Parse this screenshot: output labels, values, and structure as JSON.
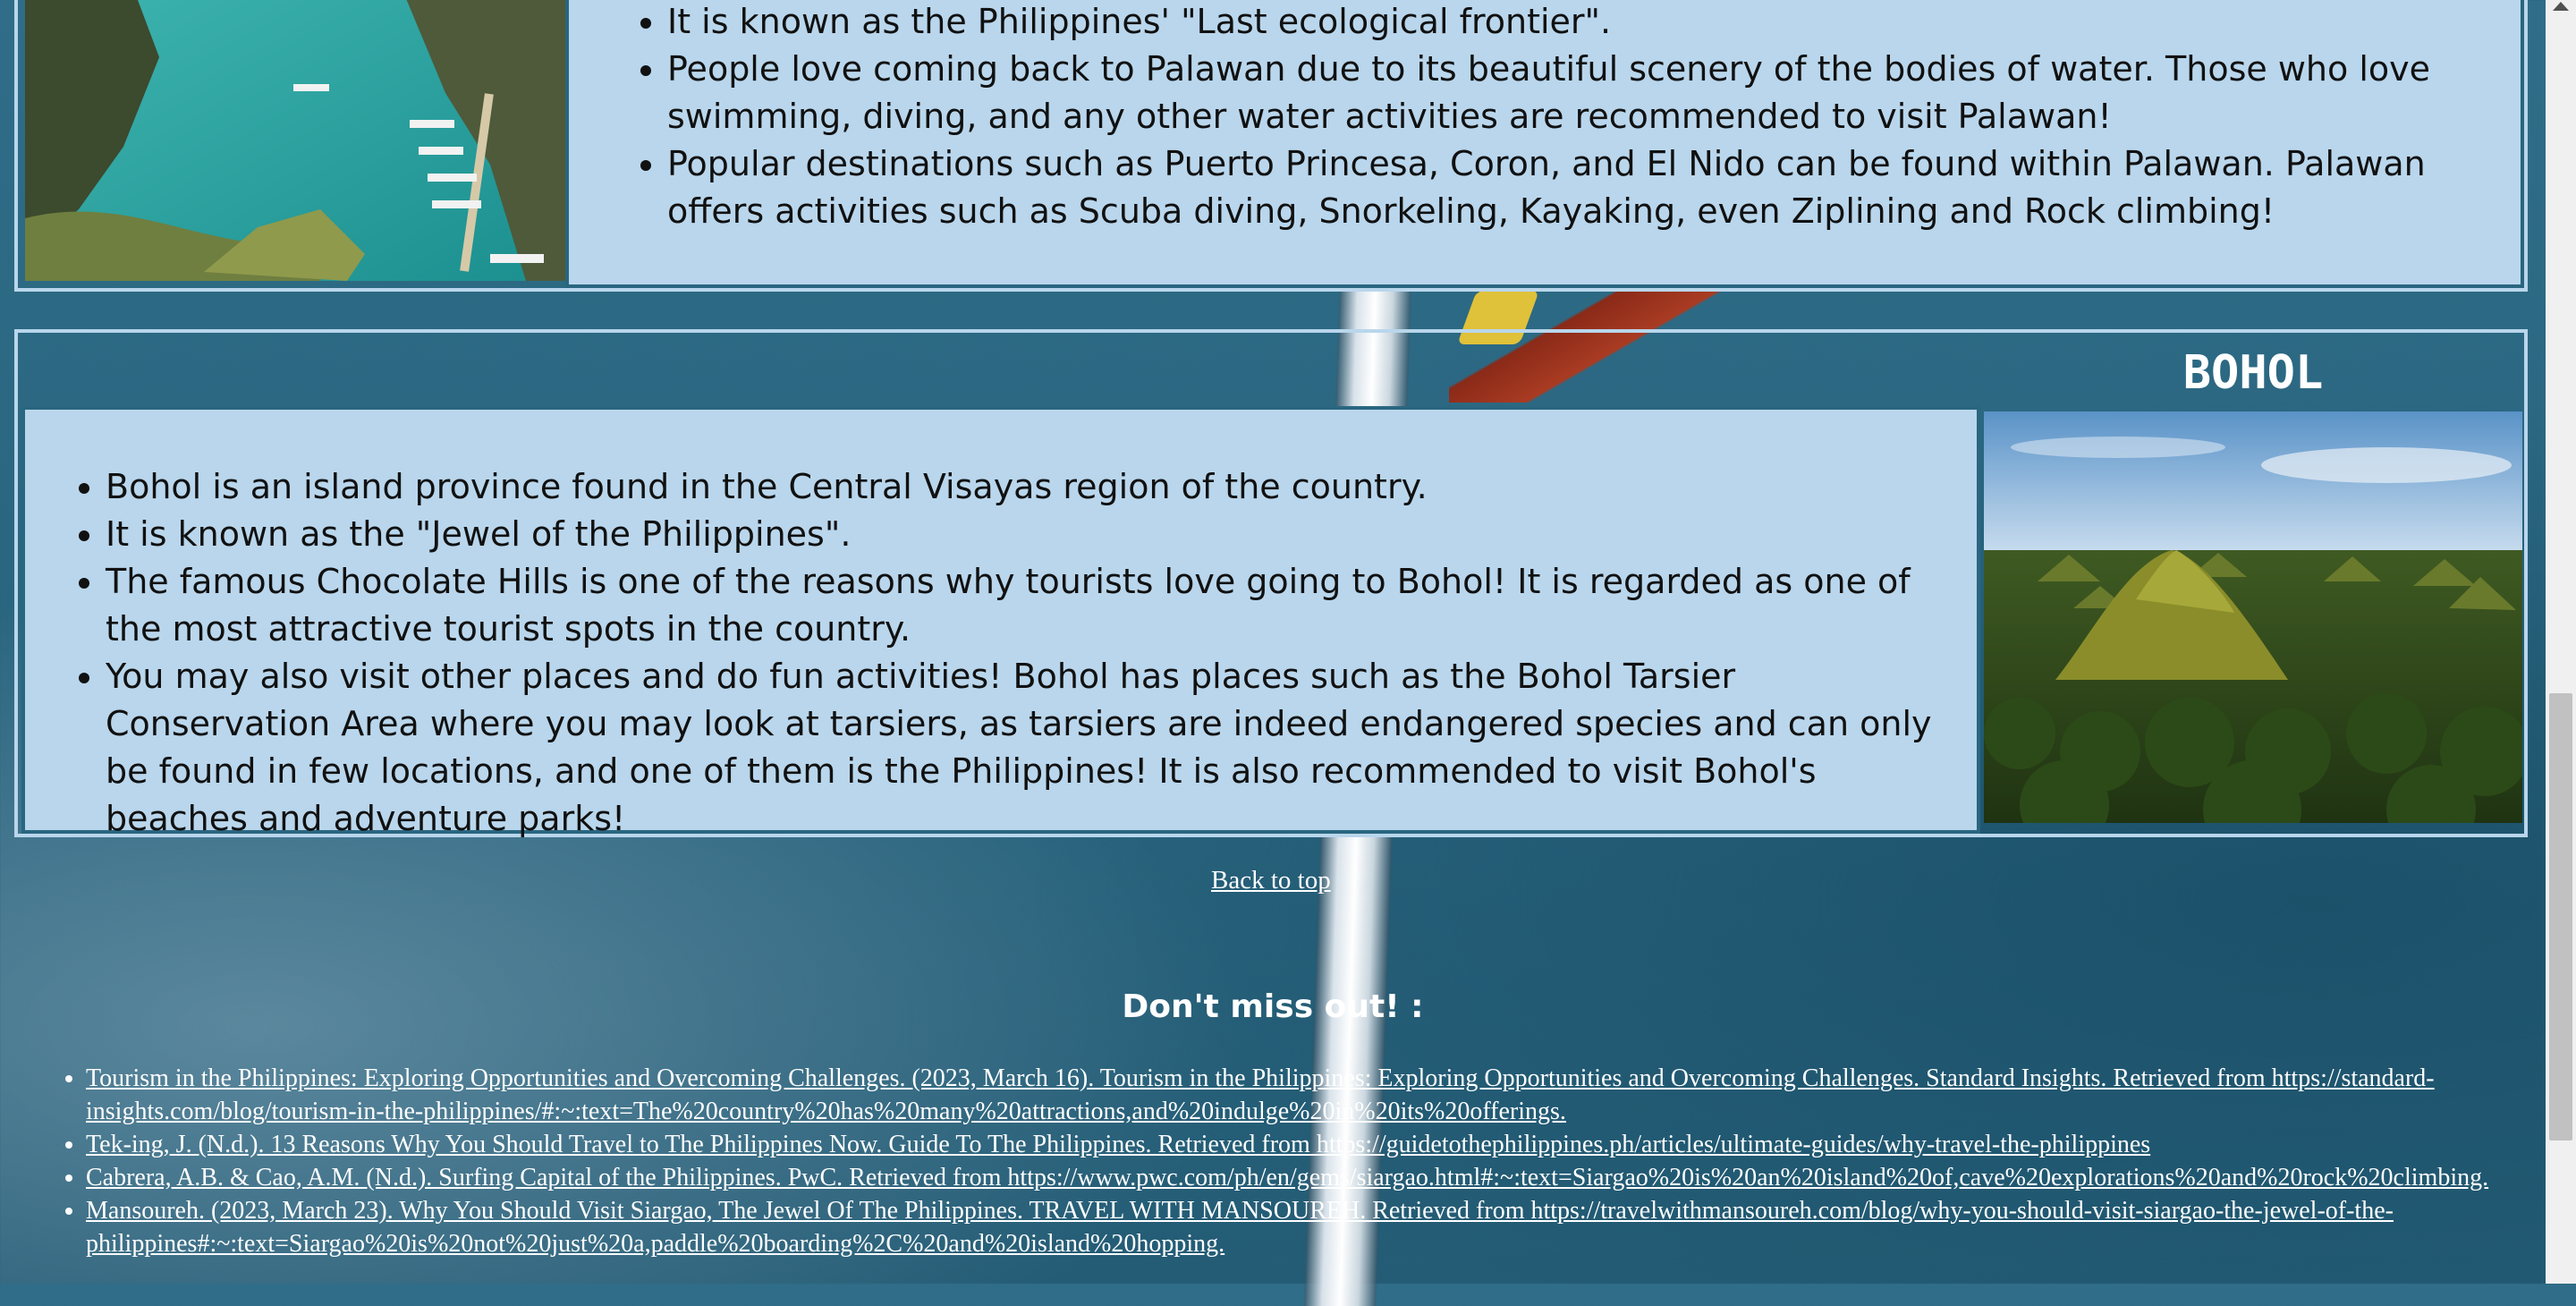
{
  "palawan": {
    "facts": [
      "It is known as the Philippines' \"Last ecological frontier\".",
      "People love coming back to Palawan due to its beautiful scenery of the bodies of water. Those who love swimming, diving, and any other water activities are recommended to visit Palawan!",
      "Popular destinations such as Puerto Princesa, Coron, and El Nido can be found within Palawan. Palawan offers activities such as Scuba diving, Snorkeling, Kayaking, even Ziplining and Rock climbing!"
    ]
  },
  "bohol": {
    "title": "BOHOL",
    "facts": [
      "Bohol is an island province found in the Central Visayas region of the country.",
      "It is known as the \"Jewel of the Philippines\".",
      "The famous Chocolate Hills is one of the reasons why tourists love going to Bohol! It is regarded as one of the most attractive tourist spots in the country.",
      "You may also visit other places and do fun activities! Bohol has places such as the Bohol Tarsier Conservation Area where you may look at tarsiers, as tarsiers are indeed endangered species and can only be found in few locations, and one of them is the Philippines! It is also recommended to visit Bohol's beaches and adventure parks!"
    ]
  },
  "back_to_top": "Back to top",
  "dont_miss": "Don't miss out! :",
  "references": [
    "Tourism in the Philippines: Exploring Opportunities and Overcoming Challenges. (2023, March 16). Tourism in the Philippines: Exploring Opportunities and Overcoming Challenges. Standard Insights. Retrieved from https://standard-insights.com/blog/tourism-in-the-philippines/#:~:text=The%20country%20has%20many%20attractions,and%20indulge%20in%20its%20offerings.",
    "Tek-ing, J. (N.d.). 13 Reasons Why You Should Travel to The Philippines Now. Guide To The Philippines. Retrieved from https://guidetothephilippines.ph/articles/ultimate-guides/why-travel-the-philippines",
    "Cabrera, A.B. & Cao, A.M. (N.d.). Surfing Capital of the Philippines. PwC. Retrieved from https://www.pwc.com/ph/en/gems/siargao.html#:~:text=Siargao%20is%20an%20island%20of,cave%20explorations%20and%20rock%20climbing.",
    "Mansoureh. (2023, March 23). Why You Should Visit Siargao, The Jewel Of The Philippines. TRAVEL WITH MANSOUREH. Retrieved from https://travelwithmansoureh.com/blog/why-you-should-visit-siargao-the-jewel-of-the-philippines#:~:text=Siargao%20is%20not%20just%20a,paddle%20boarding%2C%20and%20island%20hopping."
  ]
}
